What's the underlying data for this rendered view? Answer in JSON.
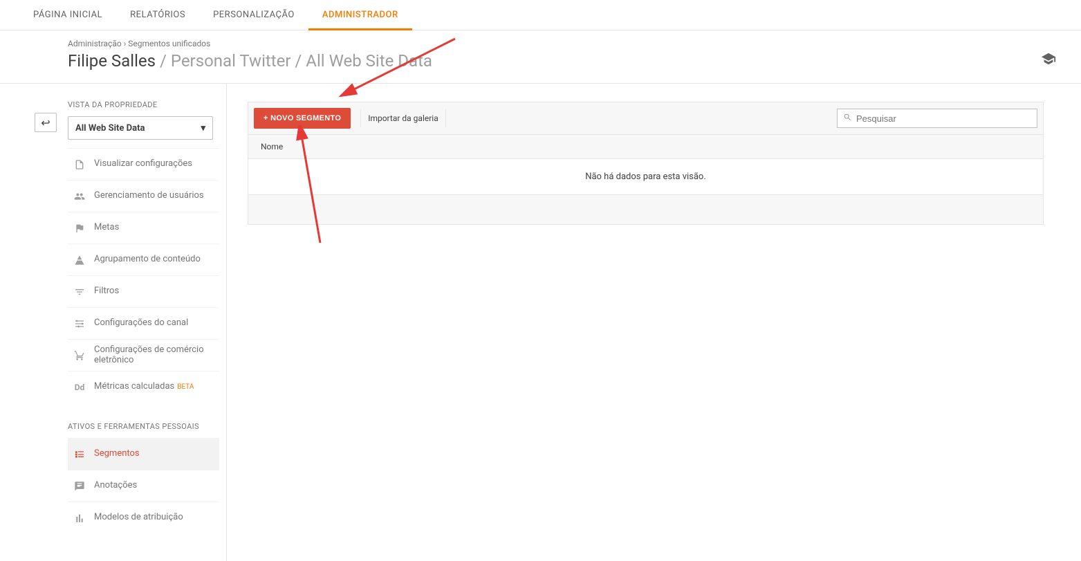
{
  "topnav": {
    "items": [
      {
        "label": "PÁGINA INICIAL"
      },
      {
        "label": "RELATÓRIOS"
      },
      {
        "label": "PERSONALIZAÇÃO"
      },
      {
        "label": "ADMINISTRADOR"
      }
    ],
    "active_index": 3
  },
  "breadcrumb": {
    "root": "Administração",
    "separator": "›",
    "current": "Segmentos unificados"
  },
  "heading": {
    "account": "Filipe Salles",
    "path": "/ Personal Twitter / All Web Site Data"
  },
  "sidebar": {
    "section_title": "VISTA DA PROPRIEDADE",
    "view_select": "All Web Site Data",
    "items": [
      {
        "icon": "file",
        "label": "Visualizar configurações"
      },
      {
        "icon": "users",
        "label": "Gerenciamento de usuários"
      },
      {
        "icon": "flag",
        "label": "Metas"
      },
      {
        "icon": "group",
        "label": "Agrupamento de conteúdo"
      },
      {
        "icon": "funnel",
        "label": "Filtros"
      },
      {
        "icon": "channel",
        "label": "Configurações do canal"
      },
      {
        "icon": "cart",
        "label": "Configurações de comércio eletrônico"
      },
      {
        "icon": "dd",
        "label": "Métricas calculadas",
        "badge": "BETA"
      }
    ],
    "tools_header": "ATIVOS E FERRAMENTAS PESSOAIS",
    "tools": [
      {
        "icon": "segments",
        "label": "Segmentos",
        "active": true
      },
      {
        "icon": "note",
        "label": "Anotações"
      },
      {
        "icon": "attribution",
        "label": "Modelos de atribuição"
      }
    ]
  },
  "main": {
    "new_segment_label": "+ NOVO SEGMENTO",
    "import_label": "Importar da galeria",
    "search_placeholder": "Pesquisar",
    "table": {
      "header_name": "Nome",
      "empty_message": "Não há dados para esta visão."
    }
  }
}
